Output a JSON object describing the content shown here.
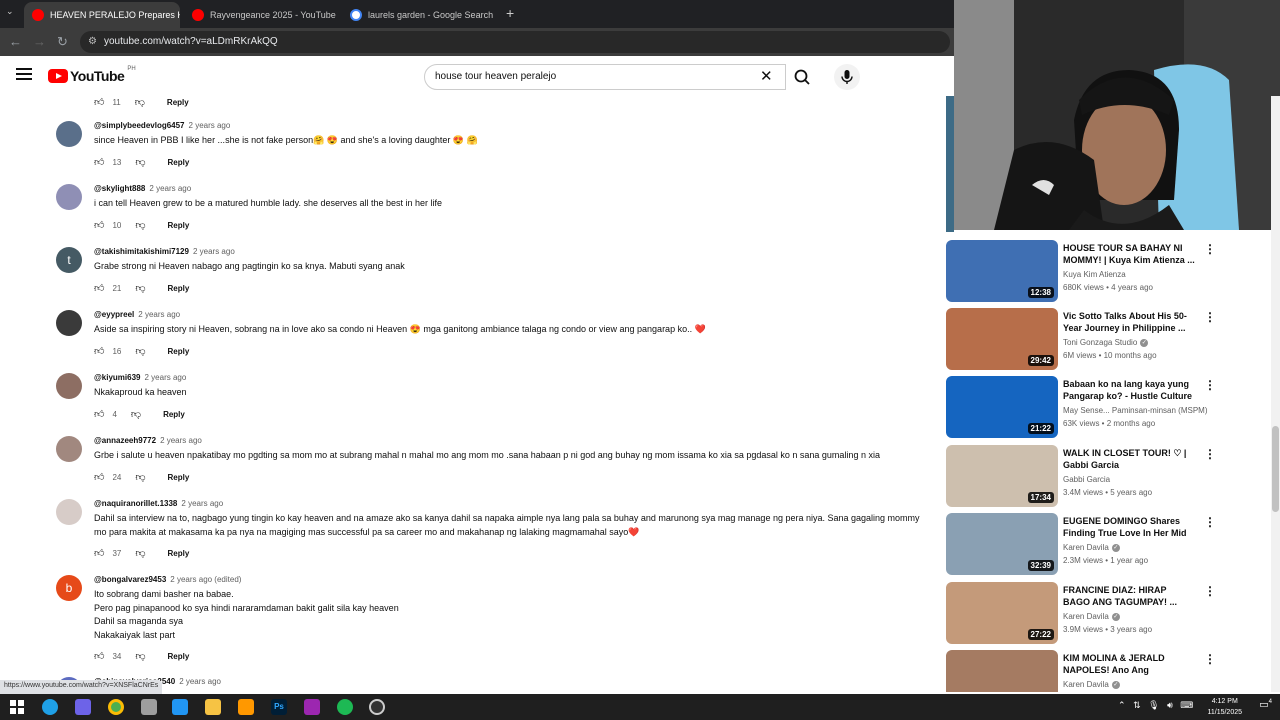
{
  "browser": {
    "tabs": [
      {
        "label": "HEAVEN PERALEJO Prepares He",
        "active": true,
        "color": "#ff0000"
      },
      {
        "label": "Rayvengeance 2025 - YouTube",
        "active": false,
        "color": "#ff0000"
      },
      {
        "label": "laurels garden - Google Search",
        "active": false,
        "color": "#ffffff"
      }
    ],
    "new_tab": "+",
    "url": "youtube.com/watch?v=aLDmRKrAkQQ"
  },
  "youtube": {
    "logo_text": "YouTube",
    "country": "PH",
    "search_value": "house tour heaven peralejo"
  },
  "comments": [
    {
      "handle": "",
      "time": "",
      "text": "",
      "likes": "11",
      "reply": "Reply",
      "actions_only": true,
      "avatar_color": "#777",
      "avatar_letter": ""
    },
    {
      "handle": "@simplybeedevlog6457",
      "time": "2 years ago",
      "text": "since Heaven in PBB I like her ...she is not fake person🤗 😍 and she's a loving daughter 😍 🤗",
      "likes": "13",
      "reply": "Reply",
      "avatar_color": "#5a6f8a",
      "avatar_letter": ""
    },
    {
      "handle": "@skylight888",
      "time": "2 years ago",
      "text": "i can tell Heaven grew to be a matured humble lady. she deserves all the best in her life",
      "likes": "10",
      "reply": "Reply",
      "avatar_color": "#8f8fb5",
      "avatar_letter": ""
    },
    {
      "handle": "@takishimitakishimi7129",
      "time": "2 years ago",
      "text": "Grabe strong ni Heaven nabago ang pagtingin ko sa knya. Mabuti syang anak",
      "likes": "21",
      "reply": "Reply",
      "avatar_color": "#455a64",
      "avatar_letter": "t"
    },
    {
      "handle": "@eyypreel",
      "time": "2 years ago",
      "text": "Aside sa inspiring story ni Heaven, sobrang na in love ako sa condo ni Heaven 😍  mga ganitong ambiance talaga ng condo or view ang pangarap ko.. ❤️",
      "likes": "16",
      "reply": "Reply",
      "avatar_color": "#3a3a3a",
      "avatar_letter": ""
    },
    {
      "handle": "@kiyumi639",
      "time": "2 years ago",
      "text": "Nkakaproud ka heaven",
      "likes": "4",
      "reply": "Reply",
      "avatar_color": "#8d6e63",
      "avatar_letter": ""
    },
    {
      "handle": "@annazeeh9772",
      "time": "2 years ago",
      "text": "Grbe i salute u heaven npakatibay mo pgdting sa mom mo at subrang mahal n mahal mo ang mom mo .sana habaan p ni god ang buhay ng mom issama ko xia sa pgdasal ko n sana gumaling n xia",
      "likes": "24",
      "reply": "Reply",
      "avatar_color": "#a1887f",
      "avatar_letter": ""
    },
    {
      "handle": "@naquiranorillet.1338",
      "time": "2 years ago",
      "text": "Dahil sa interview na to, nagbago yung tingin ko kay heaven and  na amaze ako sa kanya dahil sa napaka aimple nya lang pala sa buhay and marunong sya mag manage ng pera niya. Sana gagaling mommy mo para makita at makasama ka pa nya na magiging mas successful pa sa career mo and makahanap ng lalaking magmamahal sayo❤️",
      "likes": "37",
      "reply": "Reply",
      "avatar_color": "#d7ccc8",
      "avatar_letter": ""
    },
    {
      "handle": "@bongalvarez9453",
      "time": "2 years ago (edited)",
      "text": "Ito sobrang dami basher na babae.\nPero pag pinapanood ko sya hindi nararamdaman bakit galit sila kay heaven\nDahil sa maganda sya\nNakakaiyak last part",
      "likes": "34",
      "reply": "Reply",
      "avatar_color": "#e64a19",
      "avatar_letter": "b"
    },
    {
      "handle": "@chinayalvarico2540",
      "time": "2 years ago",
      "text": "",
      "likes": "",
      "reply": "",
      "avatar_color": "#5c6bc0",
      "avatar_letter": ""
    }
  ],
  "related": [
    {
      "title": "HOUSE TOUR SA BAHAY NI MOMMY! | Kuya Kim Atienza ...",
      "channel": "Kuya Kim Atienza",
      "verified": false,
      "stats": "680K views • 4 years ago",
      "duration": "12:38",
      "color": "#3f6fb3"
    },
    {
      "title": "Vic Sotto Talks About His 50-Year Journey in Philippine ...",
      "channel": "Toni Gonzaga Studio",
      "verified": true,
      "stats": "6M views • 10 months ago",
      "duration": "29:42",
      "color": "#b76e4a"
    },
    {
      "title": "Babaan ko na lang kaya yung Pangarap ko? - Hustle Culture ...",
      "channel": "May Sense... Paminsan-minsan (MSPM)",
      "verified": false,
      "stats": "63K views • 2 months ago",
      "duration": "21:22",
      "color": "#1565c0"
    },
    {
      "title": "WALK IN CLOSET TOUR! ♡ | Gabbi Garcia",
      "channel": "Gabbi Garcia",
      "verified": false,
      "stats": "3.4M views • 5 years ago",
      "duration": "17:34",
      "color": "#cdbfae"
    },
    {
      "title": "EUGENE DOMINGO Shares Finding True Love In Her Mid ...",
      "channel": "Karen Davila",
      "verified": true,
      "stats": "2.3M views • 1 year ago",
      "duration": "32:39",
      "color": "#8aa0b3"
    },
    {
      "title": "FRANCINE DIAZ: HIRAP BAGO ANG TAGUMPAY! ...",
      "channel": "Karen Davila",
      "verified": true,
      "stats": "3.9M views • 3 years ago",
      "duration": "27:22",
      "color": "#c49a7a"
    },
    {
      "title": "KIM MOLINA & JERALD NAPOLES! Ano Ang Kondisyon...",
      "channel": "Karen Davila",
      "verified": true,
      "stats": "",
      "duration": "",
      "color": "#a57b62"
    }
  ],
  "status_url": "https://www.youtube.com/watch?v=XNSFlaCNrEs",
  "taskbar": {
    "time": "4:12 PM",
    "date": "11/15/2025",
    "notifications": "4",
    "apps": [
      {
        "name": "windows-start-icon",
        "color": "#ffffff"
      },
      {
        "name": "edge-icon",
        "color": "#1fa0e6"
      },
      {
        "name": "copilot-icon",
        "color": "#6d63e8"
      },
      {
        "name": "chrome-icon",
        "color": "#4caf50"
      },
      {
        "name": "app-icon",
        "color": "#9e9e9e"
      },
      {
        "name": "vscode-icon",
        "color": "#2196f3"
      },
      {
        "name": "file-explorer-icon",
        "color": "#f6c344"
      },
      {
        "name": "sublime-icon",
        "color": "#ff9800"
      },
      {
        "name": "photoshop-icon",
        "color": "#31a8ff"
      },
      {
        "name": "visual-studio-icon",
        "color": "#9c27b0"
      },
      {
        "name": "spotify-icon",
        "color": "#1db954"
      },
      {
        "name": "obs-icon",
        "color": "#cccccc"
      }
    ]
  }
}
